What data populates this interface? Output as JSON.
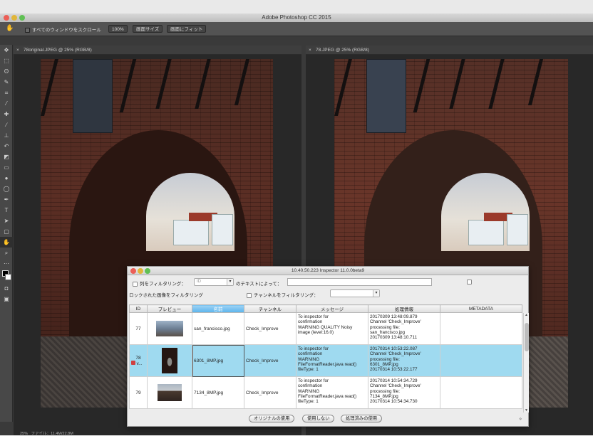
{
  "photoshop": {
    "app_title": "Adobe Photoshop CC 2015",
    "options": {
      "scroll_all_label": "すべてのウィンドウをスクロール",
      "zoom_100": "100%",
      "fit_screen": "画面サイズ",
      "fill_screen": "画面にフィット"
    },
    "tabs": {
      "left": "78original.JPEG @ 25% (RGB/8)",
      "right": "78.JPEG @ 25% (RGB/8)"
    },
    "status_left": "25%",
    "status_info": "ファイル：11.4M/22.8M"
  },
  "inspector": {
    "title": "10.40.50.223   Inspector 11.0.0beta9",
    "filter_column_label": "列をフィルタリング：",
    "filter_column_placeholder": "ID",
    "filter_text_label": "のテキストによって：",
    "locked_filter_label": "ロックされた画像をフィルタリング",
    "channel_filter_label": "チャンネルをフィルタリング：",
    "columns": [
      "ID",
      "プレビュー",
      "名前",
      "チャンネル",
      "メッセージ",
      "処理情報",
      "METADATA"
    ],
    "rows": [
      {
        "id": "77",
        "name": "san_francisco.jpg",
        "channel": "Check_Improve",
        "message": "To inspector for\nconfirmation\nWARNING QUALITY Noisy\nimage (level:16.0)",
        "process": "20170309 13:48:09.879\nChannel 'Check_Improve'\nprocessing file:\nsan_francisco.jpg\n20170309 13:48:10.711",
        "metadata": "",
        "selected": false
      },
      {
        "id": "78",
        "id_suffix": "v...",
        "name": "6301_8MP.jpg",
        "channel": "Check_Improve",
        "message": "To inspector for\nconfirmation\nWARNING\nFileFormatReader.java read()\nfileType: 1",
        "process": "20170314 10:53:22.087\nChannel 'Check_Improve'\nprocessing file:\n6301_8MP.jpg\n20170314 10:53:22.177",
        "metadata": "",
        "selected": true
      },
      {
        "id": "79",
        "name": "7134_8MP.jpg",
        "channel": "Check_Improve",
        "message": "To inspector for\nconfirmation\nWARNING\nFileFormatReader.java read()\nfileType: 1",
        "process": "20170314 10:54:34.729\nChannel 'Check_Improve'\nprocessing file:\n7134_8MP.jpg\n20170314 10:54:34.730",
        "metadata": "",
        "selected": false
      }
    ],
    "buttons": {
      "use_original": "オリジナルの使用",
      "dont_use": "使用しない",
      "use_processed": "処理済みの使用"
    }
  },
  "colors": {
    "selection": "#9fdaf0",
    "header_active": "#5ab4ec"
  }
}
